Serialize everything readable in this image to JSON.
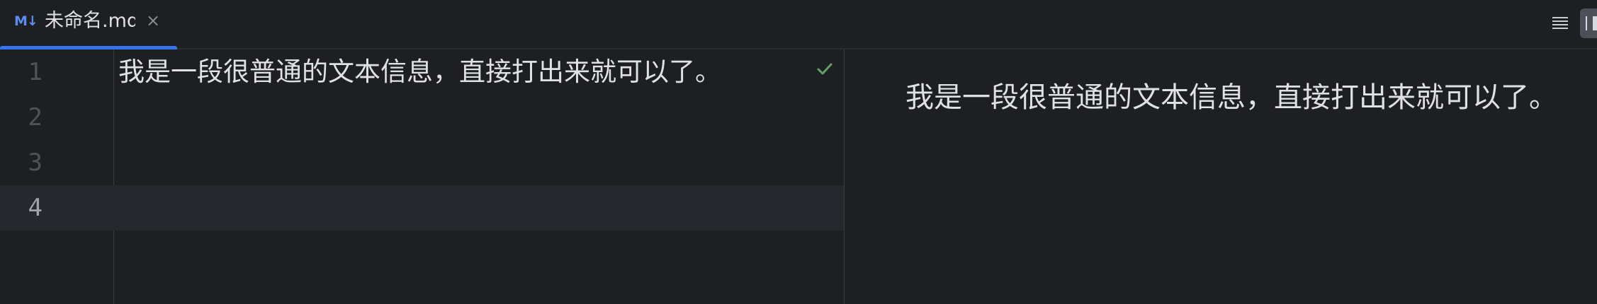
{
  "tab": {
    "file_icon": "M↓",
    "title": "未命名.md",
    "close": "×",
    "active": true
  },
  "toolbar": {
    "menu_icon": "menu-icon",
    "split_view_icon": "split-view-icon"
  },
  "editor": {
    "lines": [
      {
        "number": "1",
        "text": "我是一段很普通的文本信息，直接打出来就可以了。"
      },
      {
        "number": "2",
        "text": ""
      },
      {
        "number": "3",
        "text": ""
      },
      {
        "number": "4",
        "text": ""
      }
    ],
    "current_line": 4,
    "status_icon": "check-icon"
  },
  "preview": {
    "paragraph": "我是一段很普通的文本信息，直接打出来就可以了。"
  },
  "colors": {
    "background": "#1e1f22",
    "accent": "#3574f0",
    "text": "#dfe1e5",
    "line_number": "#4f525a",
    "current_line_bg": "#26282e",
    "check": "#5fa35f"
  }
}
